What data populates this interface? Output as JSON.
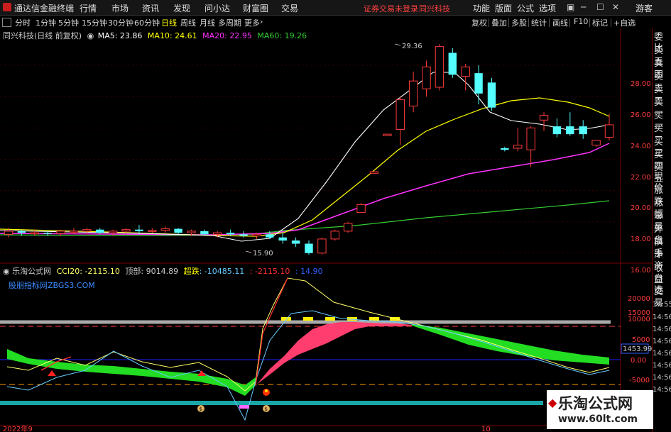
{
  "titlebar": {
    "app_title": "通达信金融终端",
    "menu": [
      "行情",
      "市场",
      "资讯",
      "发现",
      "问小达",
      "财富圈",
      "交易"
    ],
    "warning": "证券交易未登录",
    "stock": "同兴科技",
    "right_menu": [
      "功能",
      "版面",
      "公式",
      "选项"
    ],
    "guest": "游客"
  },
  "periods": [
    "分时",
    "1分钟",
    "5分钟",
    "15分钟",
    "30分钟",
    "60分钟",
    "日线",
    "周线",
    "月线",
    "多周期",
    "更多"
  ],
  "active_period": "日线",
  "toolbar": [
    "复权",
    "叠加",
    "多股",
    "统计",
    "画线",
    "F10",
    "标记",
    "+自选"
  ],
  "right_panel": [
    "委比",
    "卖五",
    "卖四",
    "卖三",
    "卖二",
    "卖一",
    "买一",
    "买二",
    "买三",
    "买四",
    "买五",
    "现价",
    "涨跌",
    "涨幅",
    "总量",
    "外盘",
    "换手",
    "净资",
    "收益",
    "自选",
    "交易"
  ],
  "main_chart": {
    "stock_label": "同兴科技(日线 前复权)",
    "ma": [
      {
        "name": "MA5",
        "value": "23.86",
        "color": "#ffffff"
      },
      {
        "name": "MA10",
        "value": "24.61",
        "color": "#ffff00"
      },
      {
        "name": "MA20",
        "value": "22.95",
        "color": "#ff33ff"
      },
      {
        "name": "MA60",
        "value": "19.26",
        "color": "#33cc33"
      }
    ],
    "price_labels": [
      "28.00",
      "26.00",
      "24.00",
      "22.00",
      "20.00",
      "18.00",
      "16.00"
    ],
    "high_label": "29.36",
    "low_label": "15.90"
  },
  "sub_chart": {
    "indicator": "乐淘公式网",
    "cci_label": "CCI20: -2115.10",
    "top_label": "顶部: 9014.89",
    "over_name": "超跌",
    "over_value": "-10485.11",
    "val1": "-2115.10",
    "val2": "14.90",
    "site": "股朋指标网ZBGS3.COM",
    "axis_labels": [
      "20000",
      "15000",
      "10000",
      "5000",
      "0.00",
      "-5000"
    ],
    "price_tag": "1453.99",
    "right_times": [
      "14:55",
      "14:56",
      "14:56",
      "14:56",
      "14:56",
      "14:56",
      "14:56",
      "14:56"
    ]
  },
  "bottom_axis": {
    "left": "2022年9",
    "mid": "10"
  },
  "watermark": {
    "name": "乐淘公式网",
    "url": "www.60lt.com"
  },
  "chart_data": {
    "type": "candlestick",
    "ylim": [
      15.4,
      30.0
    ],
    "candles": [
      [
        17.2,
        17.6,
        17.0,
        17.4
      ],
      [
        17.4,
        17.5,
        17.1,
        17.3
      ],
      [
        17.3,
        17.5,
        17.1,
        17.3
      ],
      [
        17.3,
        17.4,
        17.1,
        17.25
      ],
      [
        17.25,
        17.5,
        17.1,
        17.4
      ],
      [
        17.4,
        17.6,
        17.2,
        17.4
      ],
      [
        17.4,
        17.6,
        17.2,
        17.5
      ],
      [
        17.5,
        17.6,
        17.2,
        17.3
      ],
      [
        17.3,
        17.5,
        17.1,
        17.4
      ],
      [
        17.4,
        17.6,
        17.2,
        17.5
      ],
      [
        17.5,
        17.8,
        17.2,
        17.4
      ],
      [
        17.4,
        17.6,
        17.3,
        17.45
      ],
      [
        17.45,
        17.7,
        17.3,
        17.55
      ],
      [
        17.55,
        17.6,
        17.2,
        17.3
      ],
      [
        17.3,
        17.5,
        17.1,
        17.4
      ],
      [
        17.4,
        17.5,
        17.1,
        17.2
      ],
      [
        17.2,
        17.4,
        17.0,
        17.3
      ],
      [
        17.3,
        17.5,
        17.1,
        17.2
      ],
      [
        17.2,
        17.4,
        17.0,
        17.1
      ],
      [
        17.1,
        17.3,
        16.9,
        17.2
      ],
      [
        17.2,
        17.4,
        16.9,
        17.0
      ],
      [
        17.0,
        17.3,
        16.6,
        16.8
      ],
      [
        16.8,
        17.0,
        16.4,
        16.6
      ],
      [
        16.6,
        16.8,
        15.9,
        16.0
      ],
      [
        16.0,
        17.0,
        15.9,
        16.9
      ],
      [
        16.9,
        17.5,
        16.8,
        17.4
      ],
      [
        17.4,
        18.0,
        17.3,
        17.9
      ],
      [
        18.6,
        19.2,
        18.6,
        19.1
      ],
      [
        21.1,
        21.2,
        21.1,
        21.2
      ],
      [
        23.5,
        23.6,
        23.5,
        23.6
      ],
      [
        23.9,
        26.0,
        22.9,
        25.8
      ],
      [
        25.4,
        27.6,
        25.0,
        27.0
      ],
      [
        26.5,
        28.3,
        26.0,
        27.9
      ],
      [
        26.6,
        29.36,
        26.4,
        29.2
      ],
      [
        28.8,
        29.1,
        27.2,
        27.4
      ],
      [
        27.3,
        28.1,
        26.4,
        27.9
      ],
      [
        27.5,
        28.0,
        25.5,
        26.2
      ],
      [
        26.9,
        27.2,
        25.1,
        25.3
      ],
      [
        22.7,
        22.8,
        22.5,
        22.6
      ],
      [
        22.7,
        24.0,
        22.5,
        22.9
      ],
      [
        22.6,
        24.1,
        21.5,
        24.0
      ],
      [
        24.5,
        25.0,
        23.8,
        24.8
      ],
      [
        24.1,
        24.6,
        23.4,
        23.6
      ],
      [
        24.1,
        25.0,
        23.5,
        23.6
      ],
      [
        24.1,
        24.5,
        23.3,
        23.6
      ],
      [
        22.9,
        23.2,
        22.8,
        23.2
      ],
      [
        23.4,
        24.9,
        23.2,
        24.2
      ]
    ]
  }
}
